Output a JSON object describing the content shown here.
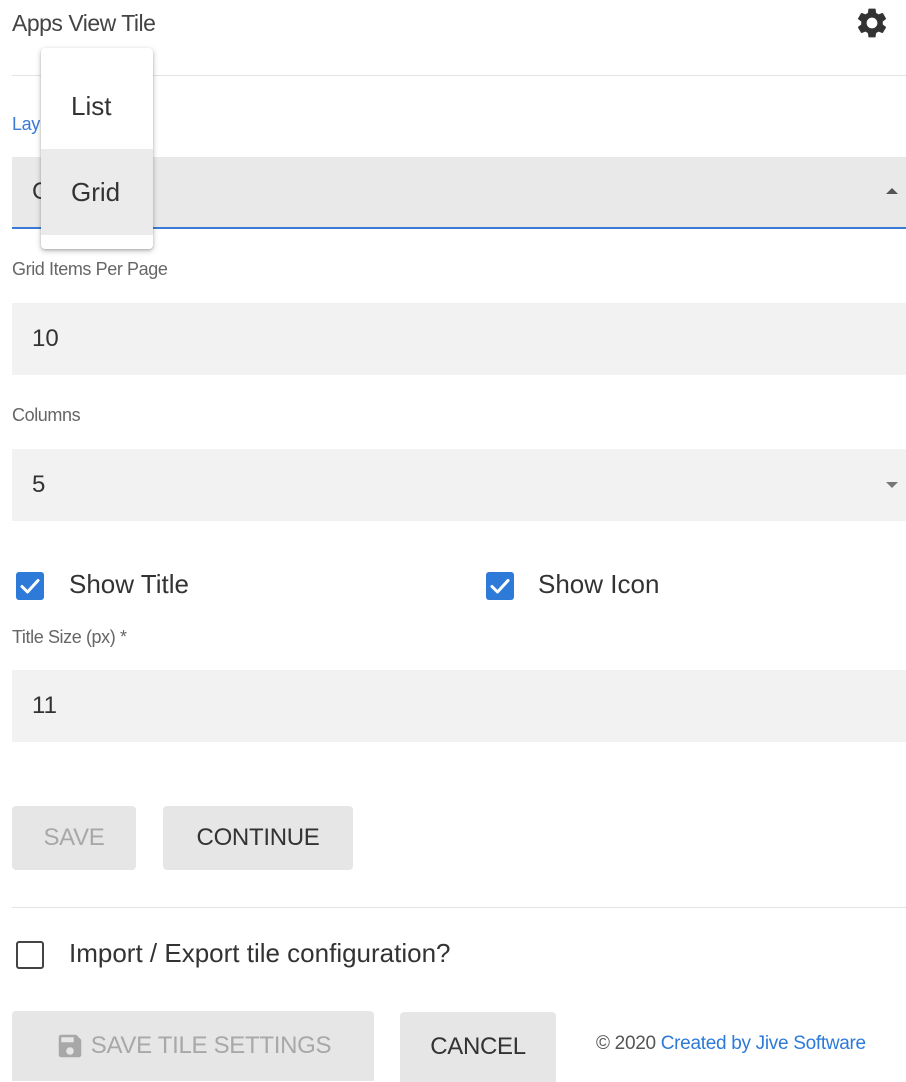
{
  "header": {
    "title": "Apps View Tile",
    "settings_icon": "gear-icon"
  },
  "layout": {
    "label": "Layout",
    "label_visible": "Lay",
    "selected": "Grid",
    "selected_visible": "C",
    "options": [
      "List",
      "Grid"
    ],
    "accent_color": "#3a7bd5"
  },
  "grid_items": {
    "label": "Grid Items Per Page",
    "value": "10"
  },
  "columns": {
    "label": "Columns",
    "value": "5"
  },
  "checks": {
    "show_title": {
      "label": "Show Title",
      "checked": true
    },
    "show_icon": {
      "label": "Show Icon",
      "checked": true
    }
  },
  "title_size": {
    "label": "Title Size (px) *",
    "value": "11"
  },
  "buttons": {
    "save": "SAVE",
    "continue": "CONTINUE"
  },
  "import_export": {
    "label": "Import / Export tile configuration?",
    "checked": false
  },
  "footer": {
    "save_tile_settings": "SAVE TILE SETTINGS",
    "cancel": "CANCEL",
    "copyright": "© 2020 ",
    "link": "Created by Jive Software"
  },
  "colors": {
    "checkbox_checked": "#2d7ad8",
    "link": "#2d7ad8"
  }
}
